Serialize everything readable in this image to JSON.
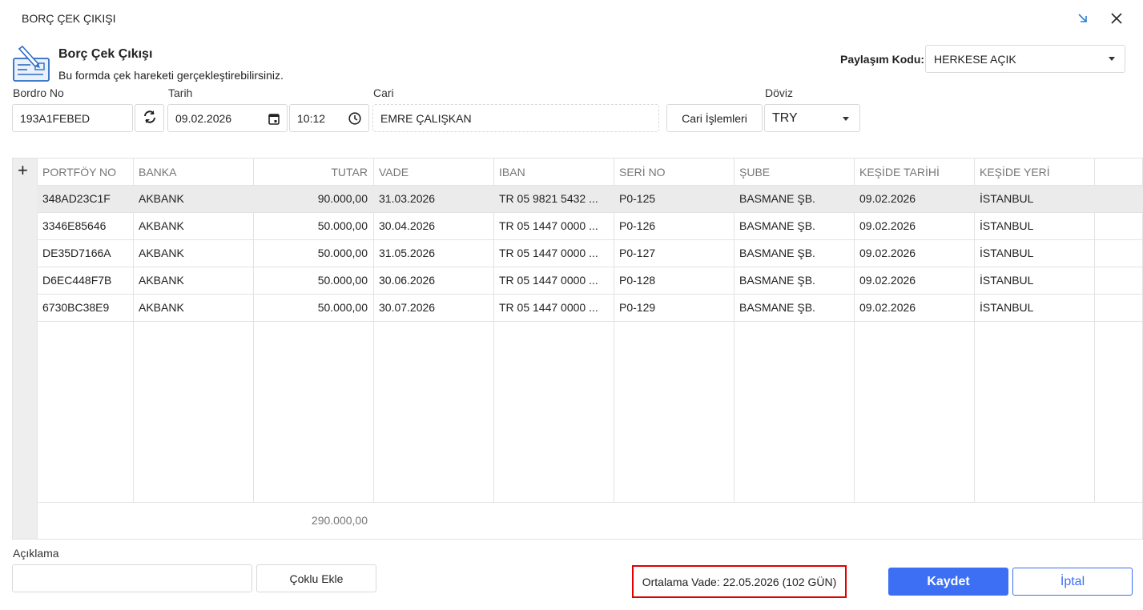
{
  "window": {
    "title": "BORÇ ÇEK ÇIKIŞI"
  },
  "header": {
    "title": "Borç Çek Çıkışı",
    "subtitle": "Bu formda çek hareketi gerçekleştirebilirsiniz.",
    "sharing_label": "Paylaşım Kodu:",
    "sharing_value": "HERKESE AÇIK"
  },
  "form": {
    "bordro_label": "Bordro No",
    "bordro_value": "193A1FEBED",
    "tarih_label": "Tarih",
    "tarih_value": "09.02.2026",
    "time_value": "10:12",
    "cari_label": "Cari",
    "cari_value": "EMRE ÇALIŞKAN",
    "cari_button": "Cari İşlemleri",
    "doviz_label": "Döviz",
    "doviz_value": "TRY"
  },
  "table": {
    "add_symbol": "+",
    "columns": [
      "PORTFÖY NO",
      "BANKA",
      "TUTAR",
      "VADE",
      "IBAN",
      "SERİ NO",
      "ŞUBE",
      "KEŞİDE TARİHİ",
      "KEŞİDE YERİ"
    ],
    "rows": [
      [
        "348AD23C1F",
        "AKBANK",
        "90.000,00",
        "31.03.2026",
        "TR 05 9821 5432 ...",
        "P0-125",
        "BASMANE ŞB.",
        "09.02.2026",
        "İSTANBUL"
      ],
      [
        "3346E85646",
        "AKBANK",
        "50.000,00",
        "30.04.2026",
        "TR 05 1447 0000 ...",
        "P0-126",
        "BASMANE ŞB.",
        "09.02.2026",
        "İSTANBUL"
      ],
      [
        "DE35D7166A",
        "AKBANK",
        "50.000,00",
        "31.05.2026",
        "TR 05 1447 0000 ...",
        "P0-127",
        "BASMANE ŞB.",
        "09.02.2026",
        "İSTANBUL"
      ],
      [
        "D6EC448F7B",
        "AKBANK",
        "50.000,00",
        "30.06.2026",
        "TR 05 1447 0000 ...",
        "P0-128",
        "BASMANE ŞB.",
        "09.02.2026",
        "İSTANBUL"
      ],
      [
        "6730BC38E9",
        "AKBANK",
        "50.000,00",
        "30.07.2026",
        "TR 05 1447 0000 ...",
        "P0-129",
        "BASMANE ŞB.",
        "09.02.2026",
        "İSTANBUL"
      ]
    ],
    "total": "290.000,00"
  },
  "footer": {
    "aciklama_label": "Açıklama",
    "aciklama_value": "",
    "coklu_button": "Çoklu Ekle",
    "ortalama_vade": "Ortalama Vade: 22.05.2026 (102 GÜN)",
    "save_button": "Kaydet",
    "cancel_button": "İptal"
  },
  "colors": {
    "accent": "#3d6ff5",
    "highlight_border": "#e00000",
    "selected_row": "#ebebeb"
  },
  "icons": [
    "minimize-arrow-icon",
    "close-icon",
    "check-document-icon",
    "refresh-icon",
    "calendar-icon",
    "clock-icon",
    "chevron-down-icon",
    "add-row-icon"
  ]
}
